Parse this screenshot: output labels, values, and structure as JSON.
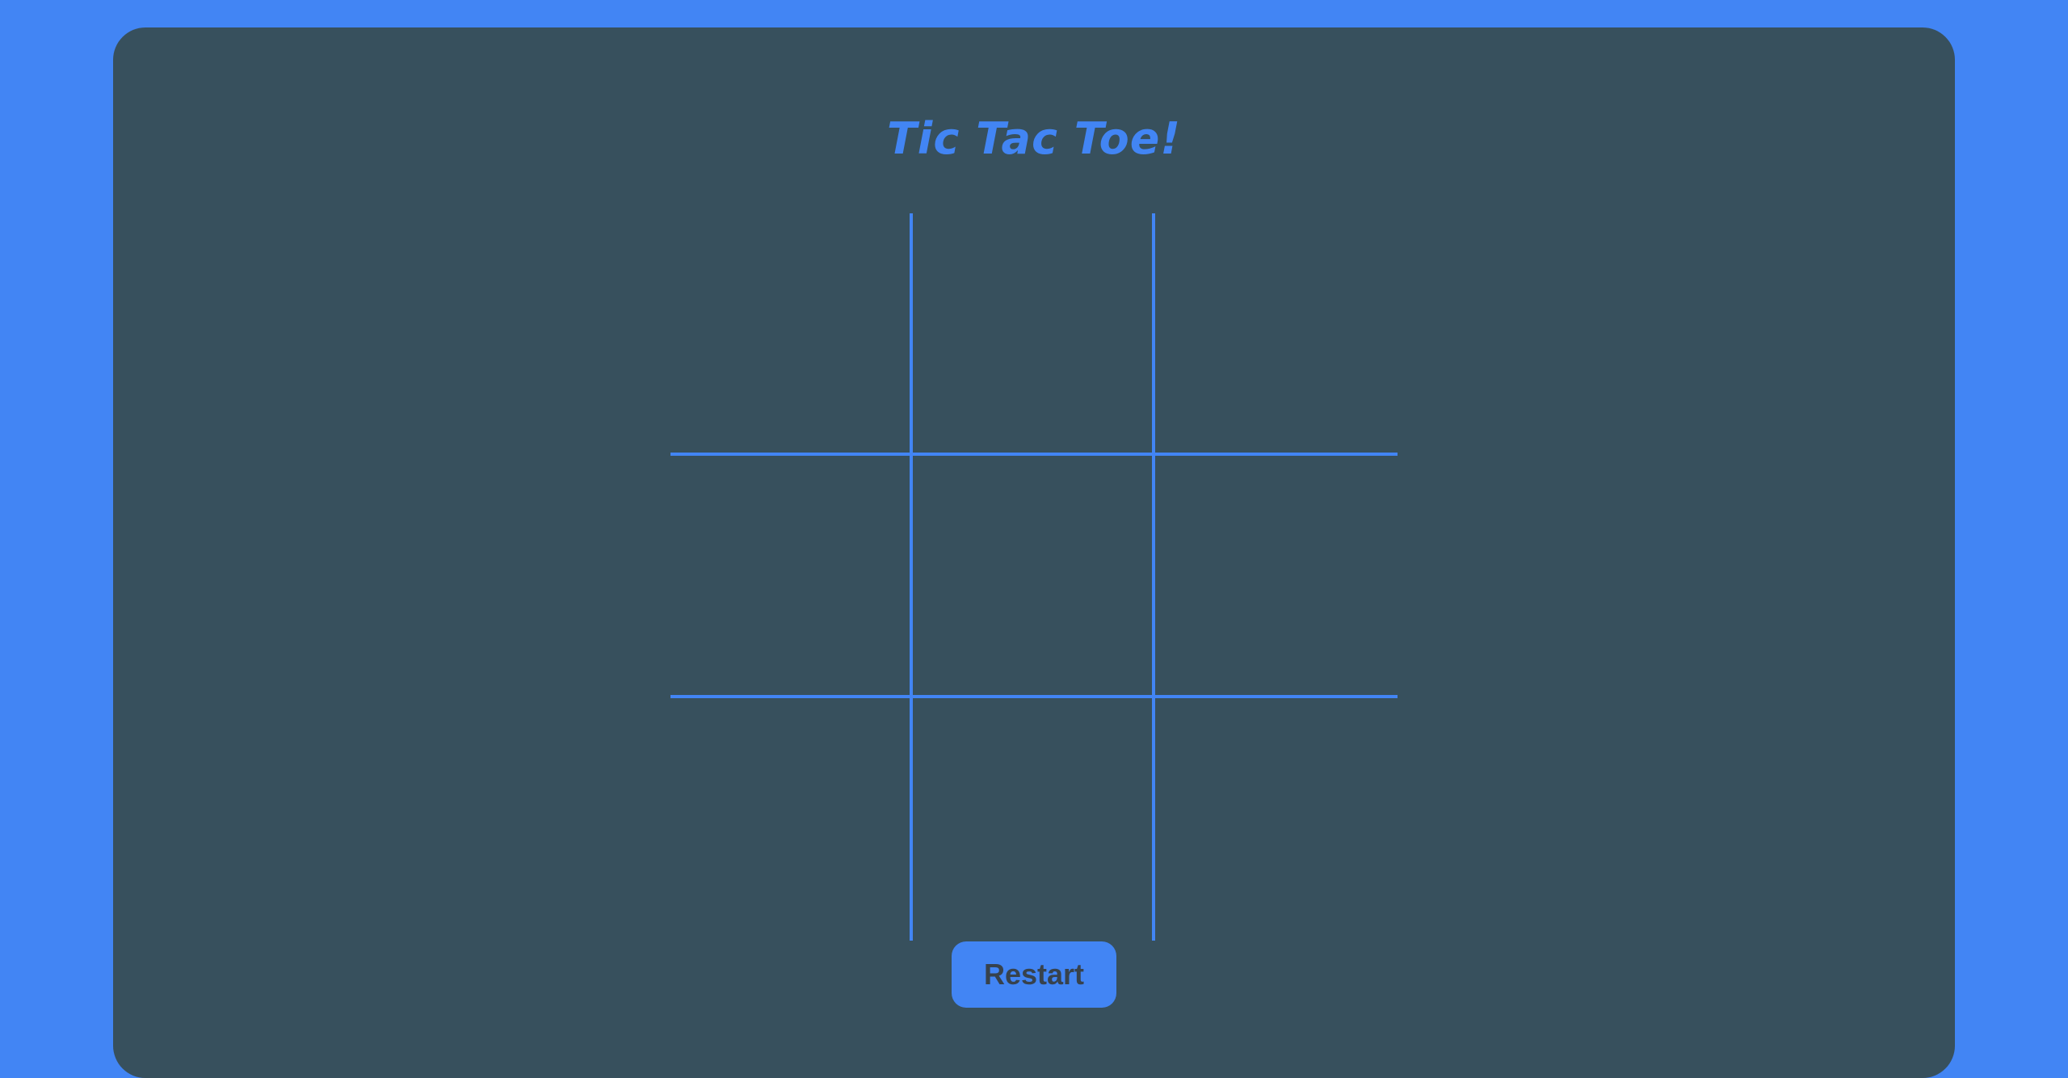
{
  "game": {
    "title": "Tic Tac Toe!",
    "board": [
      "",
      "",
      "",
      "",
      "",
      "",
      "",
      "",
      ""
    ],
    "restart_label": "Restart"
  },
  "colors": {
    "background": "#4285f4",
    "panel": "#37505d",
    "accent": "#4285f4",
    "button_text": "#37424d"
  }
}
